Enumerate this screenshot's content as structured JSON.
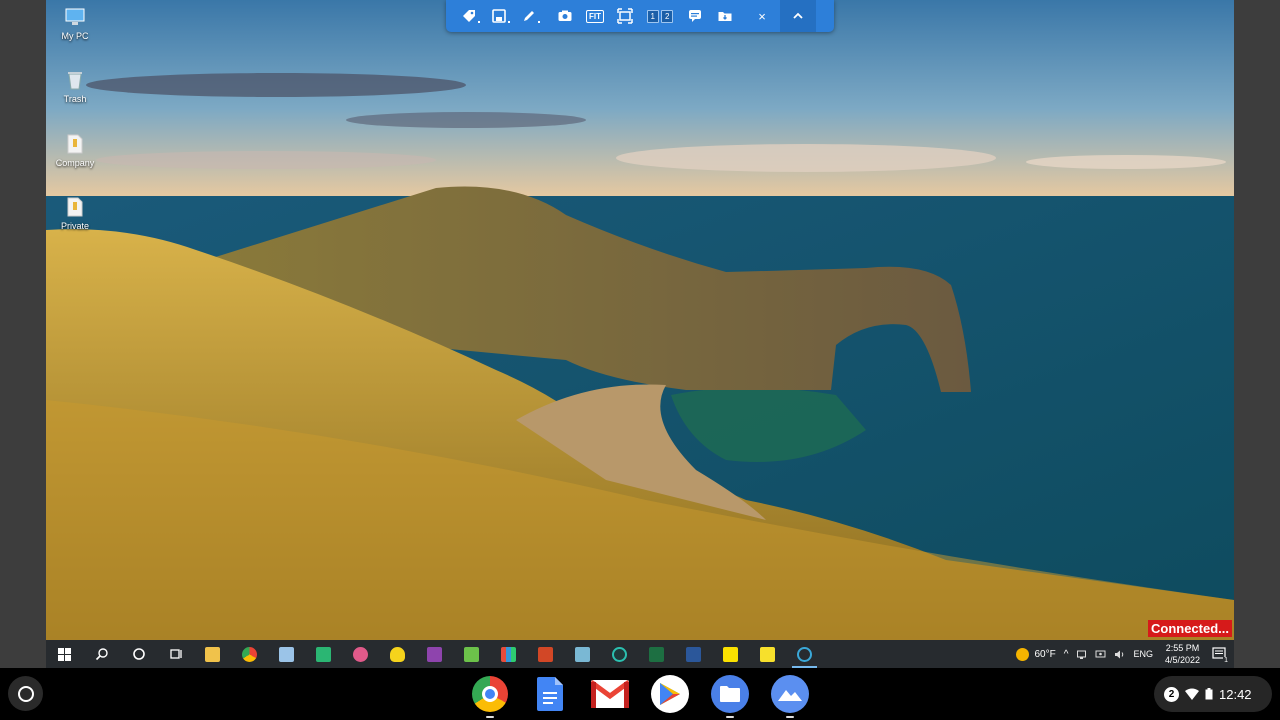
{
  "desktop": {
    "icons": [
      {
        "label": "My PC",
        "icon": "computer-icon"
      },
      {
        "label": "Trash",
        "icon": "recycle-bin-icon"
      },
      {
        "label": "Company",
        "icon": "file-icon"
      },
      {
        "label": "Private",
        "icon": "file-icon"
      }
    ]
  },
  "remote_toolbar": {
    "buttons": [
      "tag-icon",
      "save-icon",
      "pen-icon",
      "camera-icon",
      "fit-icon",
      "fullscreen-icon",
      "monitors-icon",
      "chat-icon",
      "file-transfer-icon"
    ],
    "fit_label": "FIT",
    "monitor_1": "1",
    "monitor_2": "2",
    "close_label": "×",
    "collapse_label": "⌃"
  },
  "status_banner": "Connected...",
  "windows_taskbar": {
    "apps": [
      "start-icon",
      "search-icon",
      "cortana-icon",
      "task-view-icon",
      "file-explorer-icon",
      "chrome-icon",
      "paint-icon",
      "green-app-icon",
      "paint-brush-icon",
      "duck-icon",
      "star-app-icon",
      "notepad-icon",
      "colorful-app-icon",
      "powerpoint-icon",
      "app-icon",
      "camera-app-icon",
      "excel-icon",
      "word-icon",
      "kakao-icon",
      "sticky-notes-icon",
      "remote-app-icon"
    ],
    "weather": "60°F",
    "language": "ENG",
    "time": "2:55 PM",
    "date": "4/5/2022",
    "notification_count": "1"
  },
  "chromeos_shelf": {
    "apps": [
      "chrome-icon",
      "docs-icon",
      "gmail-icon",
      "play-store-icon",
      "files-icon",
      "photos-icon"
    ],
    "notification_count": "2",
    "time": "12:42"
  },
  "colors": {
    "toolbar_blue": "#2d7fd9",
    "connected_red": "#d61a1a",
    "taskbar_bg": "#272b2f",
    "shelf_bg": "#000000"
  }
}
